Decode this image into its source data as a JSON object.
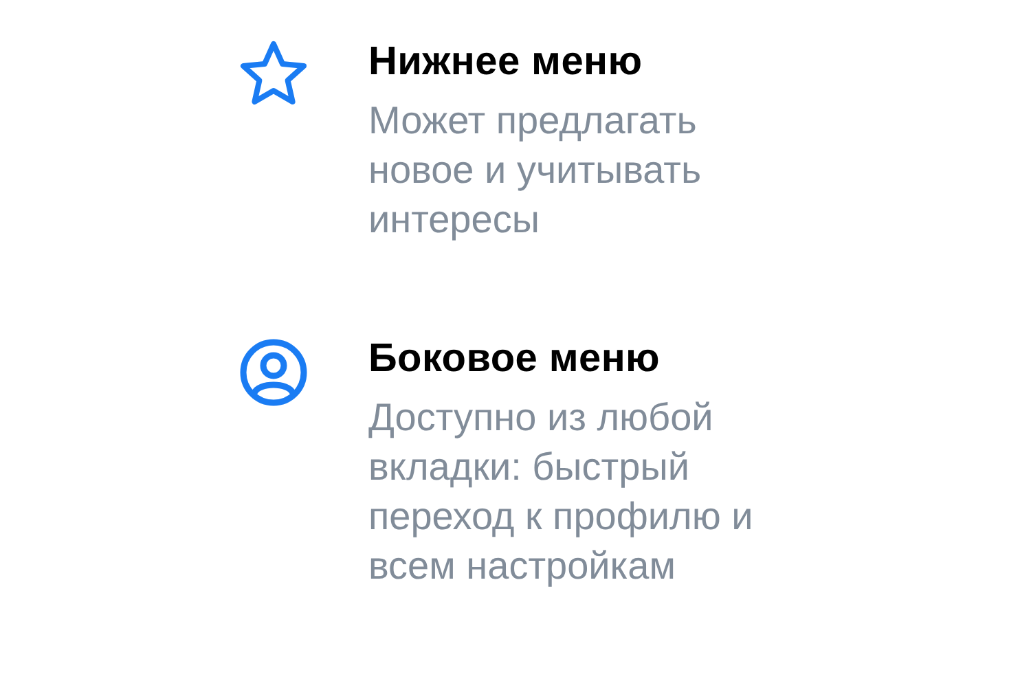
{
  "items": [
    {
      "kind": "star",
      "title": "Нижнее меню",
      "description": "Может предлагать новое и учитывать интересы"
    },
    {
      "kind": "profile",
      "title": "Боковое меню",
      "description": "Доступно из любой вкладки: быстрый переход к профилю и всем настройкам"
    }
  ]
}
